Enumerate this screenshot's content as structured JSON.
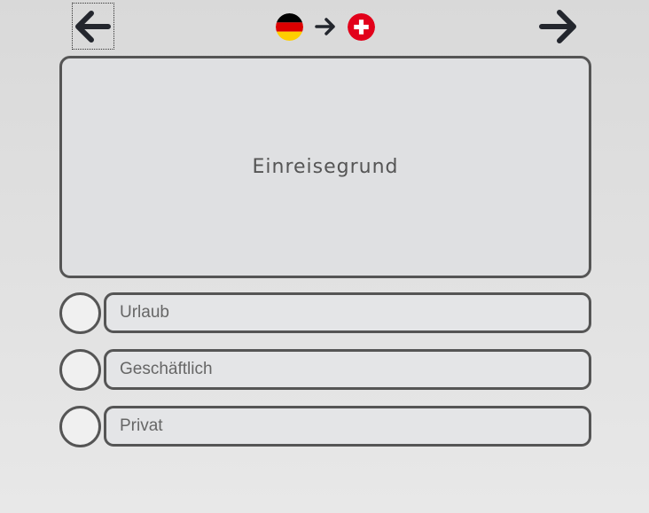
{
  "navigation": {
    "back_icon": "arrow-left-icon",
    "forward_icon": "arrow-right-icon"
  },
  "route": {
    "from_flag_icon": "germany-flag-icon",
    "arrow_icon": "arrow-right-icon",
    "to_flag_icon": "switzerland-flag-icon"
  },
  "question": {
    "text": "Einreisegrund"
  },
  "options": [
    {
      "label": "Urlaub",
      "selected": false
    },
    {
      "label": "Geschäftlich",
      "selected": false
    },
    {
      "label": "Privat",
      "selected": false
    }
  ],
  "colors": {
    "border": "#555555",
    "icon": "#23262d",
    "card_background": "#dfe0e2",
    "option_background": "#e4e5e7",
    "radio_background": "#f0f0f0",
    "swiss_red": "#e2001a",
    "german_black": "#000000",
    "german_red": "#dd0000",
    "german_gold": "#ffce00"
  }
}
